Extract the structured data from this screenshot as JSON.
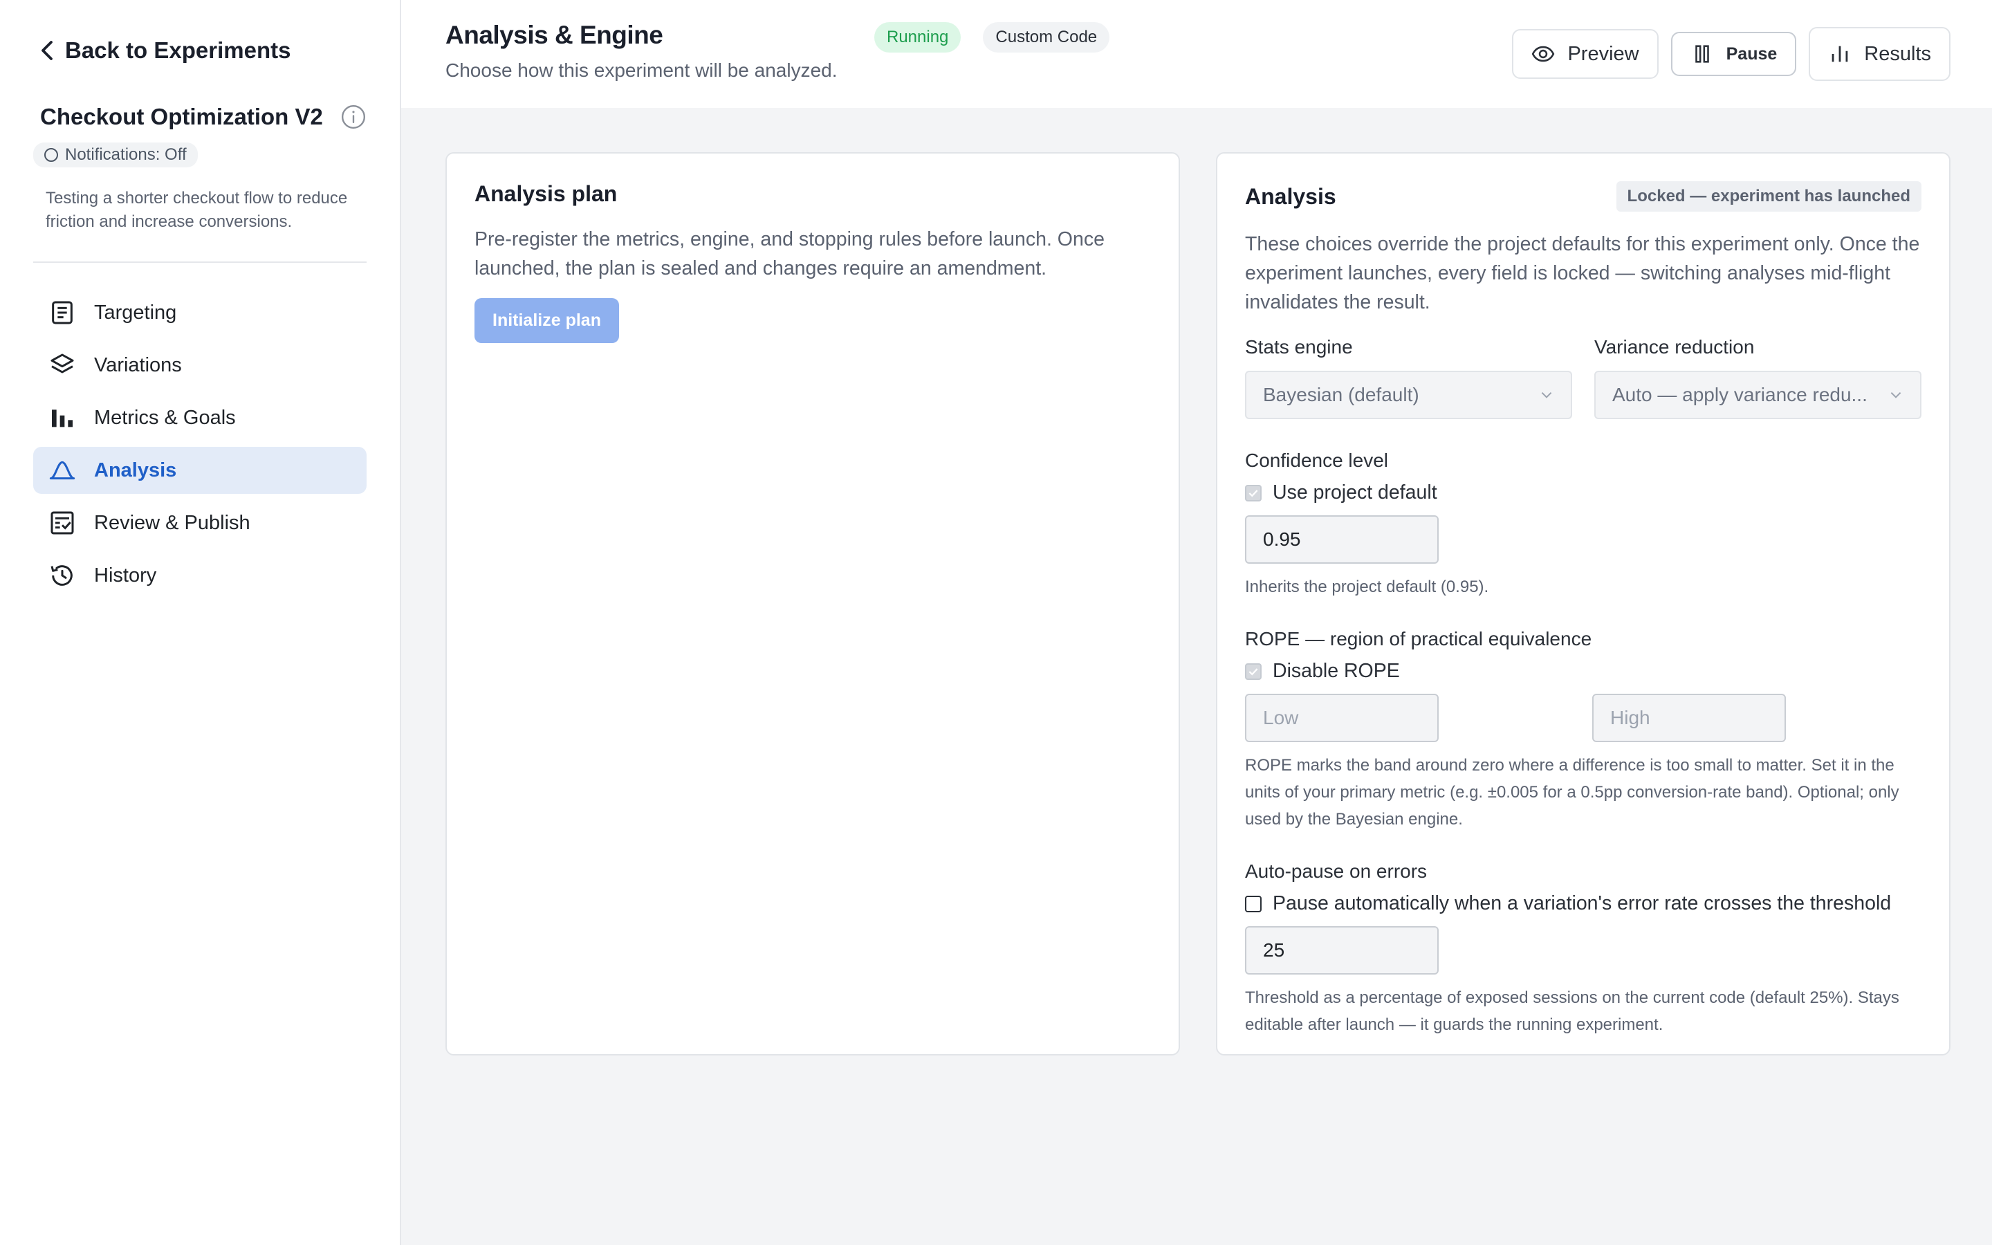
{
  "sidebar": {
    "back_label": "Back to Experiments",
    "experiment_title": "Checkout Optimization V2",
    "notifications_label": "Notifications: Off",
    "description": "Testing a shorter checkout flow to reduce friction and increase conversions.",
    "nav": [
      {
        "label": "Targeting",
        "icon": "document-icon"
      },
      {
        "label": "Variations",
        "icon": "layers-icon"
      },
      {
        "label": "Metrics & Goals",
        "icon": "bar-chart-icon"
      },
      {
        "label": "Analysis",
        "icon": "bell-curve-icon",
        "active": true
      },
      {
        "label": "Review & Publish",
        "icon": "checklist-icon"
      },
      {
        "label": "History",
        "icon": "history-icon"
      }
    ]
  },
  "header": {
    "title": "Analysis & Engine",
    "subtitle": "Choose how this experiment will be analyzed.",
    "status": "Running",
    "type": "Custom Code",
    "preview_label": "Preview",
    "pause_label": "Pause",
    "results_label": "Results"
  },
  "plan_card": {
    "title": "Analysis plan",
    "text": "Pre-register the metrics, engine, and stopping rules before launch. Once launched, the plan is sealed and changes require an amendment.",
    "button_label": "Initialize plan"
  },
  "analysis_card": {
    "title": "Analysis",
    "locked_label": "Locked — experiment has launched",
    "intro": "These choices override the project defaults for this experiment only. Once the experiment launches, every field is locked — switching analyses mid-flight invalidates the result.",
    "stats_engine": {
      "label": "Stats engine",
      "value": "Bayesian (default)"
    },
    "variance_reduction": {
      "label": "Variance reduction",
      "value": "Auto — apply variance redu..."
    },
    "confidence": {
      "label": "Confidence level",
      "checkbox_label": "Use project default",
      "checked": true,
      "value": "0.95",
      "help": "Inherits the project default (0.95)."
    },
    "rope": {
      "label": "ROPE — region of practical equivalence",
      "checkbox_label": "Disable ROPE",
      "checked": true,
      "low_placeholder": "Low",
      "high_placeholder": "High",
      "help": "ROPE marks the band around zero where a difference is too small to matter. Set it in the units of your primary metric (e.g. ±0.005 for a 0.5pp conversion-rate band). Optional; only used by the Bayesian engine."
    },
    "auto_pause": {
      "label": "Auto-pause on errors",
      "checkbox_label": "Pause automatically when a variation's error rate crosses the threshold",
      "checked": false,
      "value": "25",
      "help": "Threshold as a percentage of exposed sessions on the current code (default 25%). Stays editable after launch — it guards the running experiment."
    }
  },
  "colors": {
    "accent": "#1f5fc8",
    "active_nav_bg": "#e3ebf8",
    "running_bg": "#dcf7e6",
    "running_text": "#1e9e4e",
    "init_button": "#8eb0ef"
  }
}
